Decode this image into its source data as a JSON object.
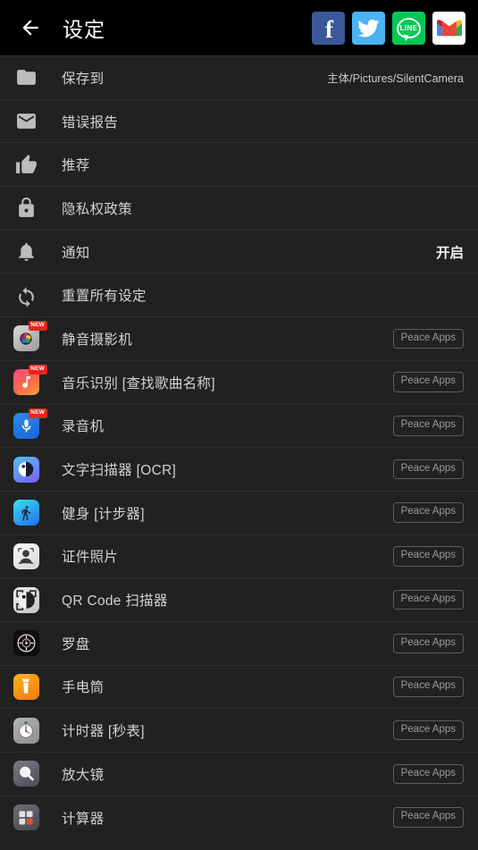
{
  "header": {
    "back_icon": "back-arrow-icon",
    "title": "设定",
    "social": [
      {
        "name": "facebook",
        "label": "f"
      },
      {
        "name": "twitter",
        "label": ""
      },
      {
        "name": "line",
        "label": "LINE"
      },
      {
        "name": "gmail",
        "label": "M"
      }
    ]
  },
  "settings": [
    {
      "icon": "folder-icon",
      "label": "保存到",
      "value": "主体/Pictures/SilentCamera",
      "value_strong": false
    },
    {
      "icon": "envelope-icon",
      "label": "错误报告",
      "value": "",
      "value_strong": false
    },
    {
      "icon": "thumbs-up-icon",
      "label": "推荐",
      "value": "",
      "value_strong": false
    },
    {
      "icon": "lock-icon",
      "label": "隐私权政策",
      "value": "",
      "value_strong": false
    },
    {
      "icon": "bell-icon",
      "label": "通知",
      "value": "开启",
      "value_strong": true
    },
    {
      "icon": "refresh-icon",
      "label": "重置所有设定",
      "value": "",
      "value_strong": false
    }
  ],
  "apps_button_label": "Peace Apps",
  "badge_label": "NEW",
  "apps": [
    {
      "icon": "silent-camera-icon",
      "label": "静音摄影机",
      "new": true
    },
    {
      "icon": "music-note-icon",
      "label": "音乐识别 [查找歌曲名称]",
      "new": true
    },
    {
      "icon": "microphone-icon",
      "label": "录音机",
      "new": true
    },
    {
      "icon": "ocr-scanner-icon",
      "label": "文字扫描器 [OCR]",
      "new": false
    },
    {
      "icon": "running-person-icon",
      "label": "健身 [计步器]",
      "new": false
    },
    {
      "icon": "id-photo-icon",
      "label": "证件照片",
      "new": false
    },
    {
      "icon": "qr-code-icon",
      "label": "QR Code 扫描器",
      "new": false
    },
    {
      "icon": "compass-icon",
      "label": "罗盘",
      "new": false
    },
    {
      "icon": "flashlight-icon",
      "label": "手电筒",
      "new": false
    },
    {
      "icon": "stopwatch-icon",
      "label": "计时器 [秒表]",
      "new": false
    },
    {
      "icon": "magnifier-icon",
      "label": "放大镜",
      "new": false
    },
    {
      "icon": "calculator-icon",
      "label": "计算器",
      "new": false
    }
  ],
  "colors": {
    "background": "#212121",
    "topbar": "#000000",
    "divider": "#2e2e2e",
    "text": "#d2d2d2",
    "facebook": "#3b5998",
    "twitter": "#4ab3f4",
    "line": "#06c755",
    "badge_red": "#e8261f"
  }
}
